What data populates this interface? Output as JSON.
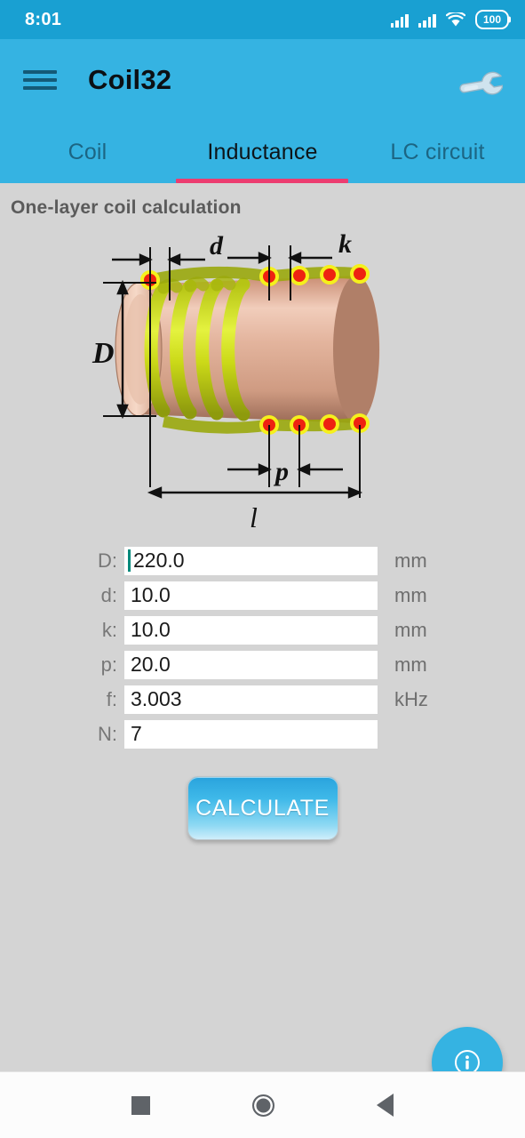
{
  "status_bar": {
    "time": "8:01",
    "battery_level": "100",
    "icons": [
      "signal-bars-icon",
      "signal-bars-icon",
      "wifi-icon",
      "battery-icon"
    ]
  },
  "app_bar": {
    "menu_icon": "hamburger-menu-icon",
    "title": "Coil32",
    "action_icon": "wrench-icon"
  },
  "tabs": [
    {
      "label": "Coil",
      "active": false
    },
    {
      "label": "Inductance",
      "active": true
    },
    {
      "label": "LC circuit",
      "active": false
    }
  ],
  "content": {
    "section_title": "One-layer coil calculation",
    "diagram": {
      "name": "one-layer-coil-diagram",
      "labels": [
        "d",
        "k",
        "D",
        "p",
        "l"
      ],
      "colors": {
        "wire": "#c3d119",
        "wire_cross_section": "#ee2211",
        "wire_ring": "#f5f01c",
        "cylinder": "#dba58c"
      }
    },
    "fields": [
      {
        "label": "D:",
        "value": "220.0",
        "unit": "mm",
        "focused": true
      },
      {
        "label": "d:",
        "value": "10.0",
        "unit": "mm",
        "focused": false
      },
      {
        "label": "k:",
        "value": "10.0",
        "unit": "mm",
        "focused": false
      },
      {
        "label": "p:",
        "value": "20.0",
        "unit": "mm",
        "focused": false
      },
      {
        "label": "f:",
        "value": "3.003",
        "unit": "kHz",
        "focused": false
      },
      {
        "label": "N:",
        "value": "7",
        "unit": "",
        "focused": false
      }
    ],
    "calculate_button": "CALCULATE",
    "fab_icon": "info-icon"
  },
  "navigation_bar": {
    "recents_icon": "square-recents-icon",
    "home_icon": "circle-home-icon",
    "back_icon": "triangle-back-icon"
  },
  "colors": {
    "status_bar": "#19a0d2",
    "app_bar": "#35b3e2",
    "tab_indicator": "#ec3d70",
    "content_bg": "#d4d4d4",
    "accent": "#35b3e2",
    "caret": "#00897b"
  }
}
